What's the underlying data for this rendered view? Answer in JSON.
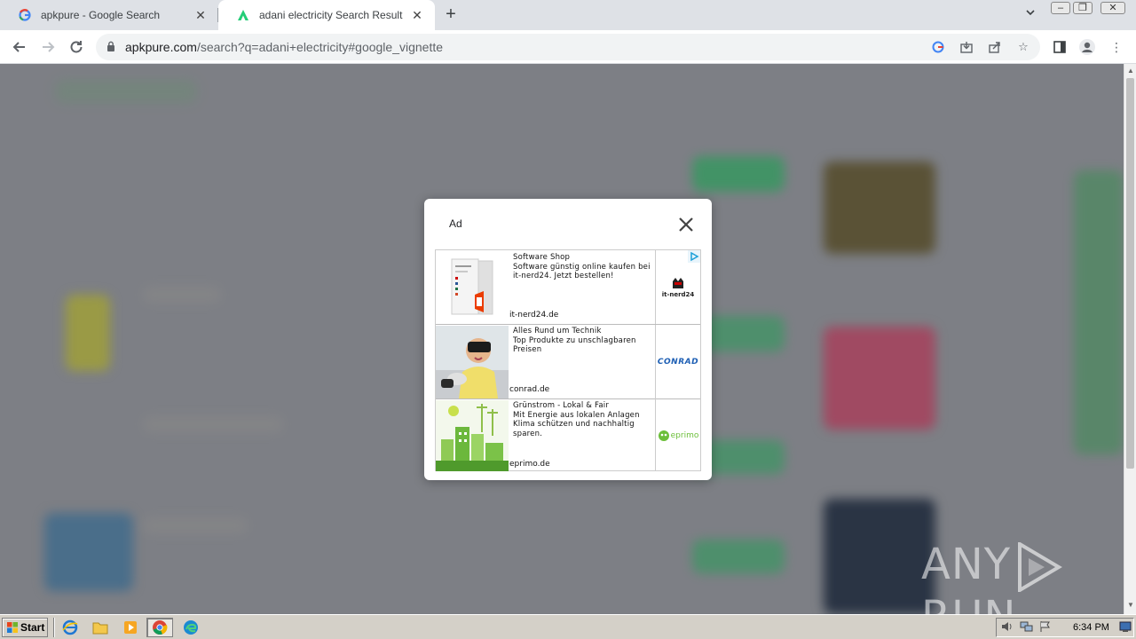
{
  "browser": {
    "tabs": [
      {
        "title": "apkpure - Google Search",
        "icon": "google-g-icon"
      },
      {
        "title": "adani electricity Search Result",
        "icon": "apkpure-icon"
      }
    ],
    "url_host": "apkpure.com",
    "url_rest": "/search?q=adani+electricity#google_vignette"
  },
  "dialog": {
    "title": "Ad",
    "ads": [
      {
        "headline": "Software Shop",
        "body": "Software günstig online kaufen bei it-nerd24. Jetzt bestellen!",
        "domain": "it-nerd24.de",
        "logo": "it-nerd24"
      },
      {
        "headline": "Alles Rund um Technik",
        "body": "Top Produkte zu unschlagbaren Preisen",
        "domain": "conrad.de",
        "logo": "CONRAD"
      },
      {
        "headline": "Grünstrom - Lokal & Fair",
        "body": "Mit Energie aus lokalen Anlagen Klima schützen und nachhaltig sparen.",
        "domain": "eprimo.de",
        "logo": "eprimo"
      }
    ]
  },
  "watermark": {
    "left": "ANY",
    "right": "RUN"
  },
  "taskbar": {
    "start_label": "Start",
    "clock": "6:34 PM"
  },
  "colors": {
    "accent_green": "#24cd77",
    "overlay": "#7d7f85",
    "conrad_blue": "#1e5fb4",
    "eprimo_green": "#6cbf3a"
  }
}
